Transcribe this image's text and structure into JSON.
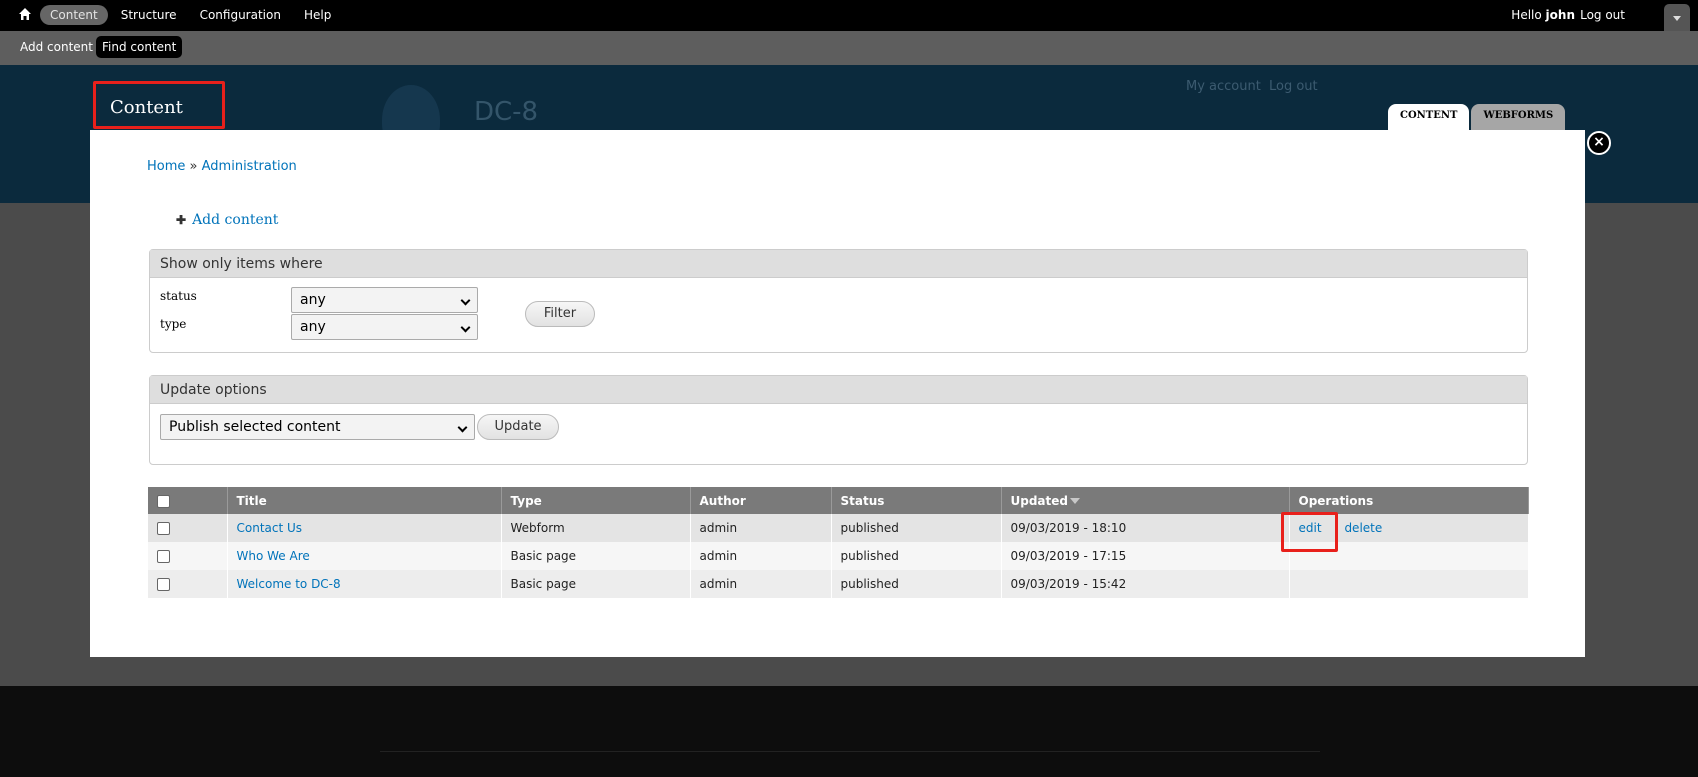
{
  "toolbar": {
    "menu": [
      "Content",
      "Structure",
      "Configuration",
      "Help"
    ],
    "greeting": "Hello",
    "username": "john",
    "logout": "Log out"
  },
  "shortcuts": [
    "Add content",
    "Find content"
  ],
  "site": {
    "name": "DC-8",
    "secondary_links": [
      "My account",
      "Log out"
    ]
  },
  "overlay": {
    "title": "Content",
    "tabs": [
      "CONTENT",
      "WEBFORMS"
    ],
    "breadcrumb": [
      "Home",
      "»",
      "Administration"
    ],
    "add_content": "Add content"
  },
  "filters": {
    "legend": "Show only items where",
    "status_label": "status",
    "status_value": "any",
    "type_label": "type",
    "type_value": "any",
    "button": "Filter"
  },
  "update_options": {
    "legend": "Update options",
    "selected": "Publish selected content",
    "button": "Update"
  },
  "table": {
    "headers": [
      "Title",
      "Type",
      "Author",
      "Status",
      "Updated",
      "Operations"
    ],
    "rows": [
      {
        "title": "Contact Us",
        "type": "Webform",
        "author": "admin",
        "status": "published",
        "updated": "09/03/2019 - 18:10",
        "ops": [
          "edit",
          "delete"
        ]
      },
      {
        "title": "Who We Are",
        "type": "Basic page",
        "author": "admin",
        "status": "published",
        "updated": "09/03/2019 - 17:15",
        "ops": []
      },
      {
        "title": "Welcome to DC-8",
        "type": "Basic page",
        "author": "admin",
        "status": "published",
        "updated": "09/03/2019 - 15:42",
        "ops": []
      }
    ]
  }
}
